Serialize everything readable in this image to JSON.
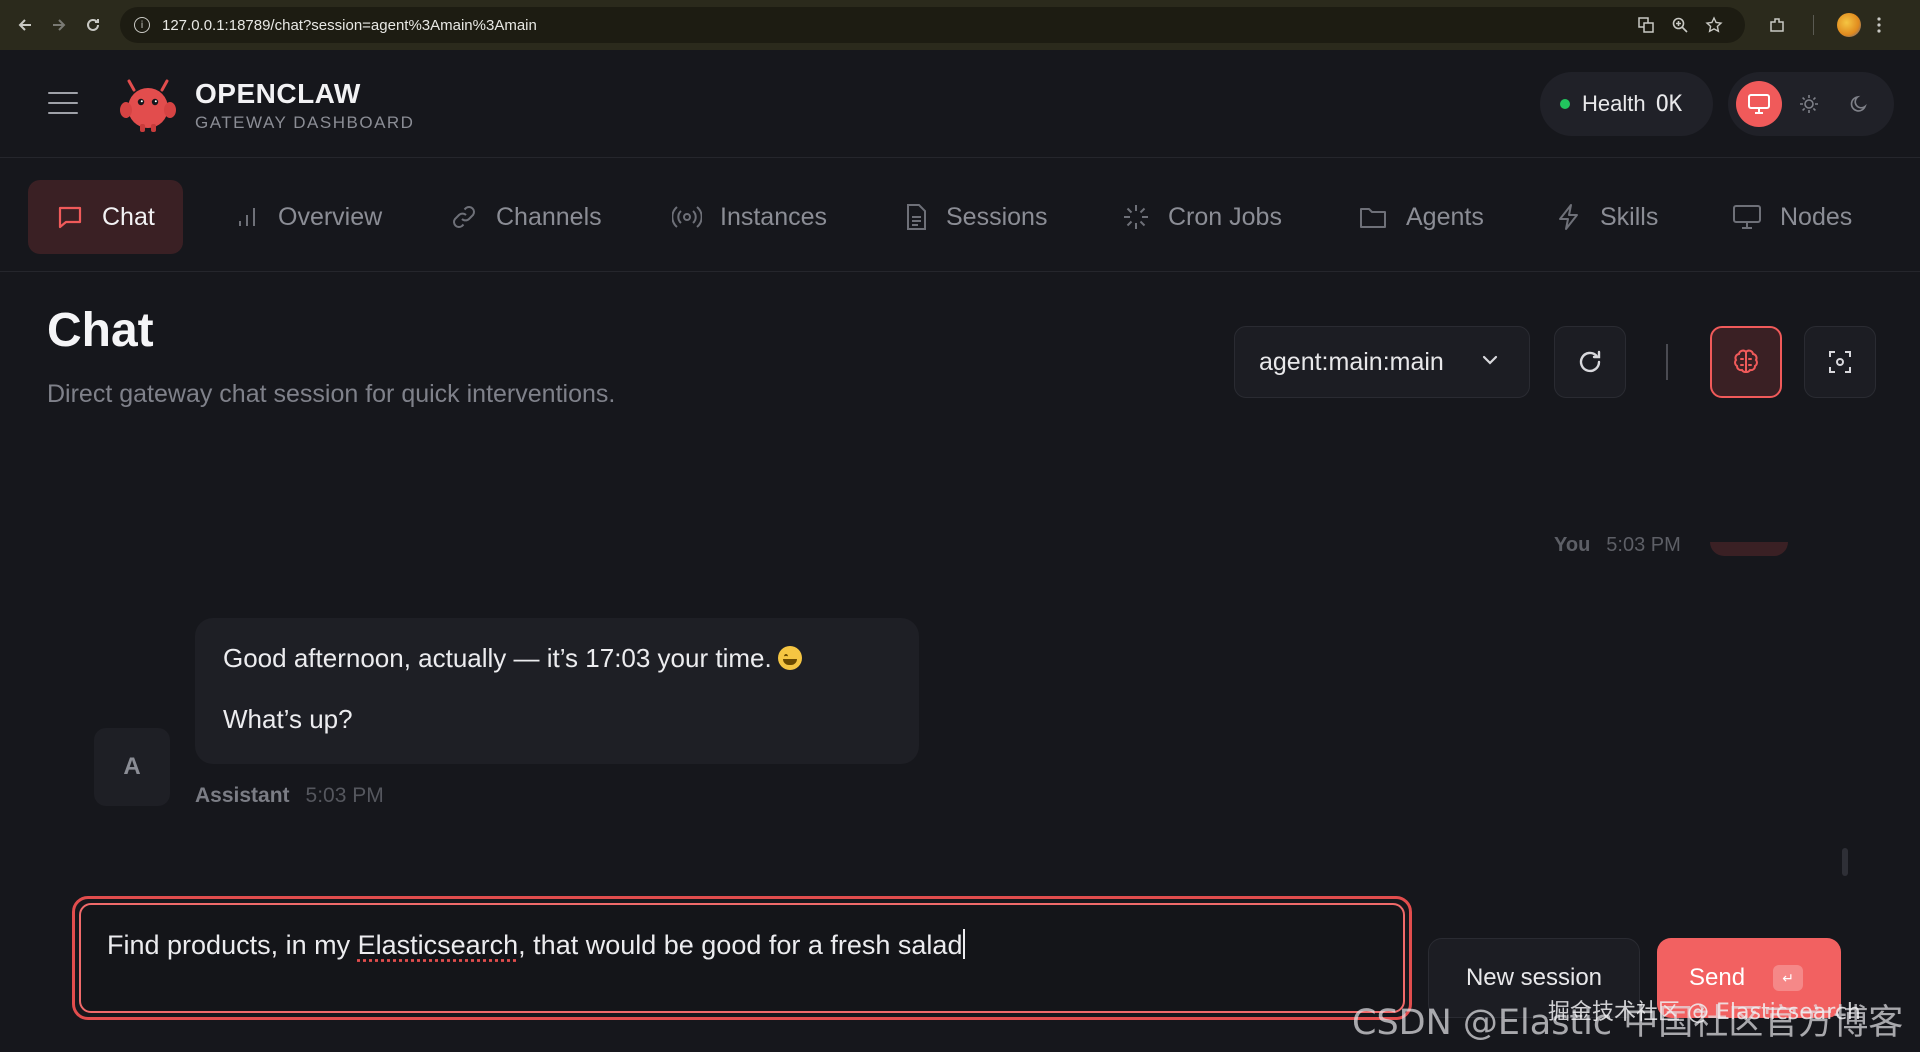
{
  "browser": {
    "url": "127.0.0.1:18789/chat?session=agent%3Amain%3Amain"
  },
  "header": {
    "brand_name": "OPENCLAW",
    "brand_sub": "GATEWAY DASHBOARD",
    "health_label": "Health",
    "health_value": "OK",
    "colors": {
      "accent": "#f05a5a",
      "health_ok": "#22c55e",
      "background": "#16171c"
    }
  },
  "tabs": [
    {
      "label": "Chat",
      "icon": "message-square-icon",
      "active": true
    },
    {
      "label": "Overview",
      "icon": "bar-chart-icon"
    },
    {
      "label": "Channels",
      "icon": "link-icon"
    },
    {
      "label": "Instances",
      "icon": "radio-icon"
    },
    {
      "label": "Sessions",
      "icon": "file-text-icon"
    },
    {
      "label": "Cron Jobs",
      "icon": "loader-icon"
    },
    {
      "label": "Agents",
      "icon": "folder-icon"
    },
    {
      "label": "Skills",
      "icon": "zap-icon"
    },
    {
      "label": "Nodes",
      "icon": "monitor-icon"
    }
  ],
  "page": {
    "title": "Chat",
    "subtitle": "Direct gateway chat session for quick interventions.",
    "session_selected": "agent:main:main"
  },
  "messages": {
    "user_meta": {
      "name": "You",
      "time": "5:03 PM"
    },
    "assistant": {
      "avatar_letter": "A",
      "line1": "Good afternoon, actually — it’s 17:03 your time.",
      "emoji": "grinning-face-emoji",
      "line2": "What’s up?",
      "name": "Assistant",
      "time": "5:03 PM"
    }
  },
  "composer": {
    "text_before": "Find products, in my ",
    "text_underlined": "Elasticsearch",
    "text_after": ", that would be good for a fresh salad",
    "new_session_label": "New session",
    "send_label": "Send",
    "send_key_hint": "↵"
  },
  "watermark": {
    "main": "CSDN @Elastic 中国社区官方博客",
    "overlay": "掘金技术社区 @ Elasticsearch"
  }
}
